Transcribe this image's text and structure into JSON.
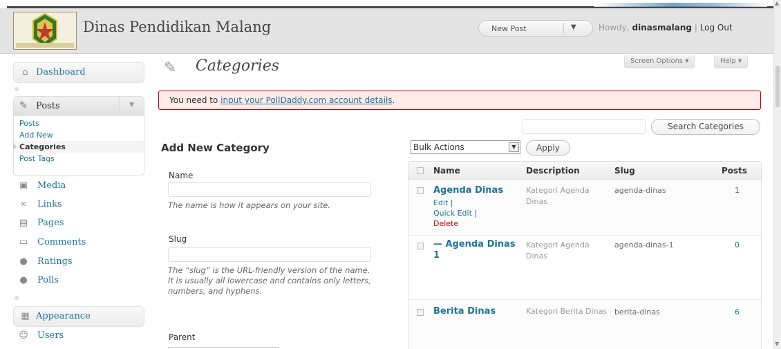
{
  "header": {
    "site_title": "Dinas Pendidikan Malang",
    "favorite_action": "New Post",
    "howdy_prefix": "Howdy,",
    "username": "dinasmalang",
    "separator": "|",
    "logout": "Log Out"
  },
  "screen_meta": {
    "screen_options": "Screen Options ▾",
    "help": "Help ▾"
  },
  "sidebar": {
    "dashboard": "Dashboard",
    "posts": "Posts",
    "posts_submenu": [
      {
        "label": "Posts"
      },
      {
        "label": "Add New"
      },
      {
        "label": "Categories"
      },
      {
        "label": "Post Tags"
      }
    ],
    "media": "Media",
    "links": "Links",
    "pages": "Pages",
    "comments": "Comments",
    "ratings": "Ratings",
    "polls": "Polls",
    "appearance": "Appearance",
    "users": "Users"
  },
  "page": {
    "title": "Categories"
  },
  "notice": {
    "before": "You need to ",
    "link": "input your PollDaddy.com account details",
    "after": "."
  },
  "search": {
    "value": "",
    "button": "Search Categories"
  },
  "form": {
    "heading": "Add New Category",
    "name_label": "Name",
    "name_value": "",
    "name_help": "The name is how it appears on your site.",
    "slug_label": "Slug",
    "slug_value": "",
    "slug_help": "The “slug” is the URL-friendly version of the name. It is usually all lowercase and contains only letters, numbers, and hyphens.",
    "parent_label": "Parent"
  },
  "table": {
    "bulk_actions": "Bulk Actions",
    "apply": "Apply",
    "columns": {
      "name": "Name",
      "description": "Description",
      "slug": "Slug",
      "posts": "Posts"
    },
    "row_actions": {
      "edit": "Edit |",
      "quick_edit": "Quick Edit |",
      "delete": "Delete"
    },
    "rows": [
      {
        "name": "Agenda Dinas",
        "description": "Kategori Agenda Dinas",
        "slug": "agenda-dinas",
        "posts": "1"
      },
      {
        "name": "— Agenda Dinas 1",
        "description": "Kategori Agenda Dinas",
        "slug": "agenda-dinas-1",
        "posts": "0"
      },
      {
        "name": "Berita Dinas",
        "description": "Kategori Berita Dinas",
        "slug": "berita-dinas",
        "posts": "6"
      }
    ]
  },
  "colors": {
    "link": "#21759b",
    "notice_bg": "#ffebe8",
    "notice_border": "#cc0000",
    "delete": "#bc0b0b",
    "header_bg": "#e4e4e4"
  }
}
